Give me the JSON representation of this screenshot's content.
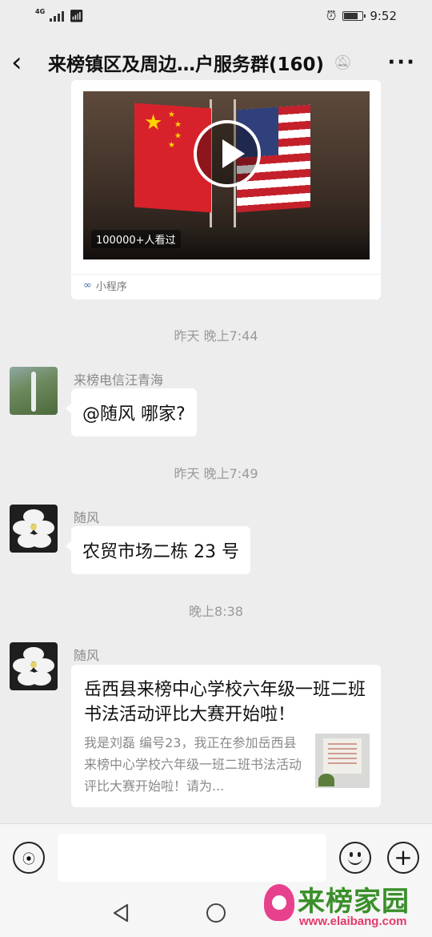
{
  "status": {
    "network": "4G",
    "time": "9:52",
    "battery_level": 0.8
  },
  "header": {
    "title": "来榜镇区及周边…户服务群(160)"
  },
  "mini_program": {
    "views": "100000+人看过",
    "tag": "小程序"
  },
  "messages": [
    {
      "timestamp": "昨天 晚上7:44",
      "sender": "来榜电信汪青海",
      "text": "@随风  哪家?"
    },
    {
      "timestamp": "昨天 晚上7:49",
      "sender": "随风",
      "text": "农贸市场二栋 23 号"
    },
    {
      "timestamp": "晚上8:38",
      "sender": "随风"
    }
  ],
  "article": {
    "title": "岳西县来榜中心学校六年级一班二班书法活动评比大赛开始啦！",
    "description": "我是刘磊 编号23，我正在参加岳西县来榜中心学校六年级一班二班书法活动评比大赛开始啦！请为..."
  },
  "input": {
    "value": ""
  },
  "watermark": {
    "brand": "来榜家园",
    "url": "www.elaibang.com"
  },
  "colors": {
    "background": "#ededed",
    "bubble": "#ffffff",
    "watermark_green": "#3a8f2a",
    "watermark_pink": "#e33a6a"
  }
}
